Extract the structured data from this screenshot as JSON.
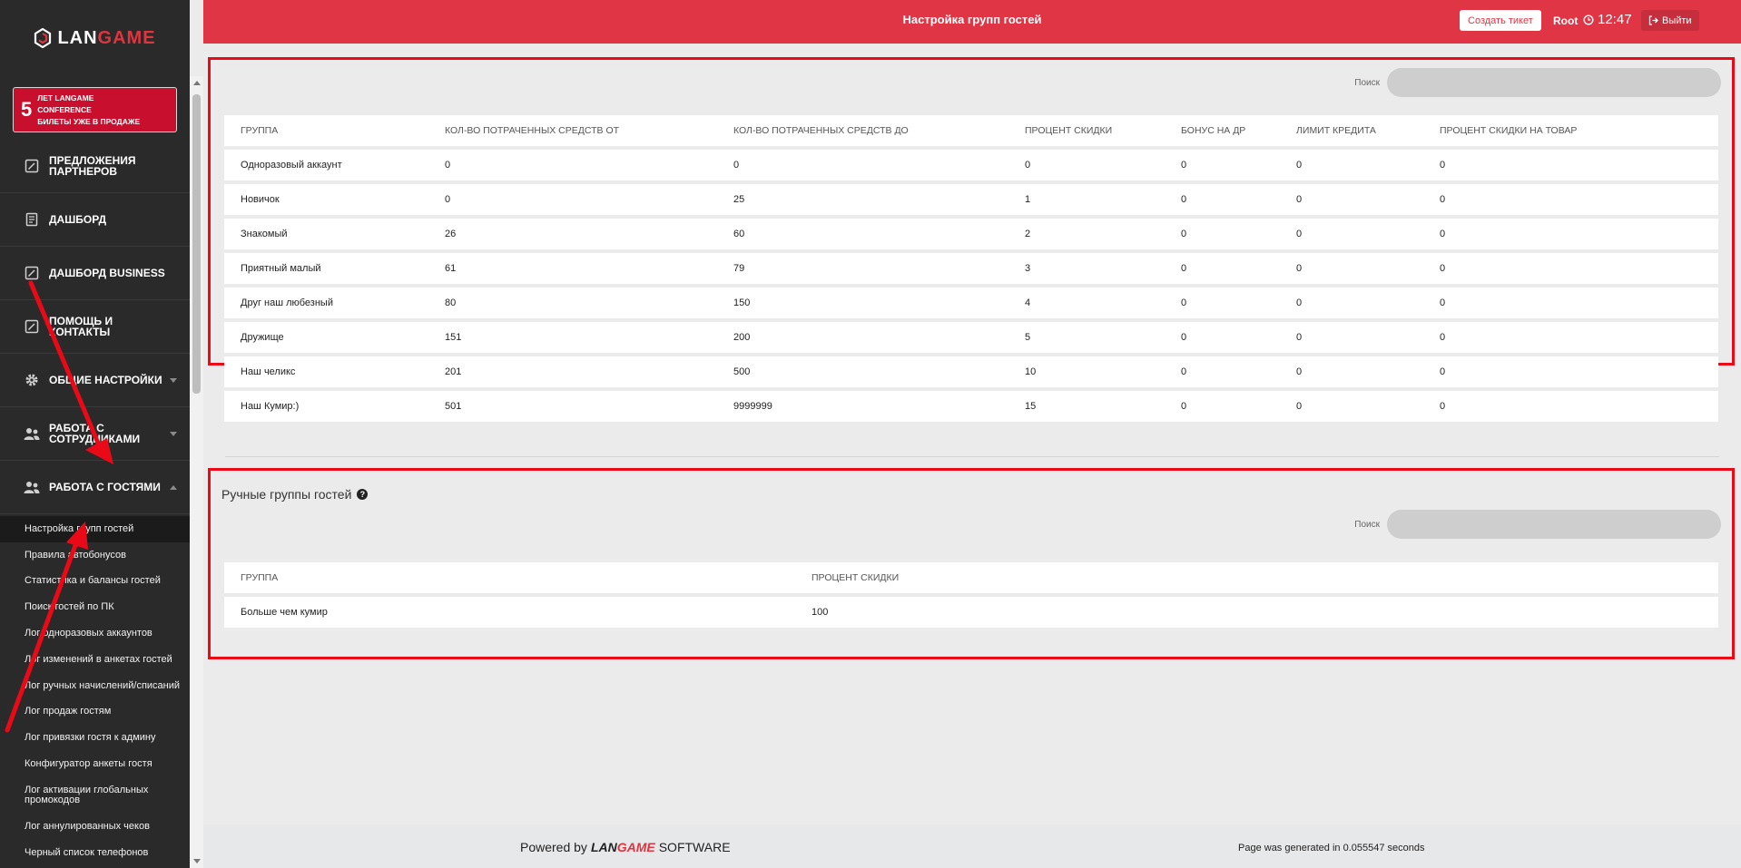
{
  "brand": {
    "lan": "LAN",
    "game": "GAME"
  },
  "promo": {
    "number": "5",
    "line1": "лет LANGAME",
    "line2": "conference",
    "line3": "билеты уже в продаже"
  },
  "sidebar": {
    "items": [
      {
        "label": "Предложения партнеров",
        "icon": "edit-icon"
      },
      {
        "label": "Дашборд",
        "icon": "book-icon"
      },
      {
        "label": "Дашборд BUSINESS",
        "icon": "edit-icon"
      },
      {
        "label": "Помощь и контакты",
        "icon": "edit-icon"
      },
      {
        "label": "Общие настройки",
        "icon": "gear-icon"
      },
      {
        "label": "Работа с сотрудниками",
        "icon": "users-icon"
      },
      {
        "label": "Работа с гостями",
        "icon": "users-icon"
      }
    ],
    "subitems": [
      "Настройка групп гостей",
      "Правила автобонусов",
      "Статистика и балансы гостей",
      "Поиск гостей по ПК",
      "Лог одноразовых аккаунтов",
      "Лог изменений в анкетах гостей",
      "Лог ручных начислений/списаний",
      "Лог продаж гостям",
      "Лог привязки гостя к админу",
      "Конфигуратор анкеты гостя",
      "Лог активации глобальных промокодов",
      "Лог аннулированных чеков",
      "Черный список телефонов"
    ]
  },
  "header": {
    "title": "Настройка групп гостей",
    "ticket_label": "Создать тикет",
    "user": "Root",
    "time": "12:47",
    "logout_label": "Выйти"
  },
  "search": {
    "label": "Поиск"
  },
  "auto_groups": {
    "columns": [
      "Группа",
      "Кол-во потраченных средств от",
      "Кол-во потраченных средств до",
      "Процент скидки",
      "Бонус на ДР",
      "Лимит кредита",
      "Процент скидки на товар"
    ],
    "rows": [
      [
        "Одноразовый аккаунт",
        "0",
        "0",
        "0",
        "0",
        "0",
        "0"
      ],
      [
        "Новичок",
        "0",
        "25",
        "1",
        "0",
        "0",
        "0"
      ],
      [
        "Знакомый",
        "26",
        "60",
        "2",
        "0",
        "0",
        "0"
      ],
      [
        "Приятный малый",
        "61",
        "79",
        "3",
        "0",
        "0",
        "0"
      ],
      [
        "Друг наш любезный",
        "80",
        "150",
        "4",
        "0",
        "0",
        "0"
      ],
      [
        "Дружище",
        "151",
        "200",
        "5",
        "0",
        "0",
        "0"
      ],
      [
        "Наш челикс",
        "201",
        "500",
        "10",
        "0",
        "0",
        "0"
      ],
      [
        "Наш Кумир:)",
        "501",
        "9999999",
        "15",
        "0",
        "0",
        "0"
      ]
    ]
  },
  "manual_groups": {
    "title": "Ручные группы гостей",
    "columns": [
      "Группа",
      "Процент скидки"
    ],
    "rows": [
      [
        "Больше чем кумир",
        "100"
      ]
    ]
  },
  "footer": {
    "powered": "Powered by",
    "brand_lan": "LAN",
    "brand_game": "GAME",
    "software": "SOFTWARE",
    "generated": "Page was generated in 0.055547 seconds"
  },
  "colors": {
    "accent": "#df3545",
    "sidebar": "#2a2a2a",
    "annotation": "#ea0a17"
  }
}
